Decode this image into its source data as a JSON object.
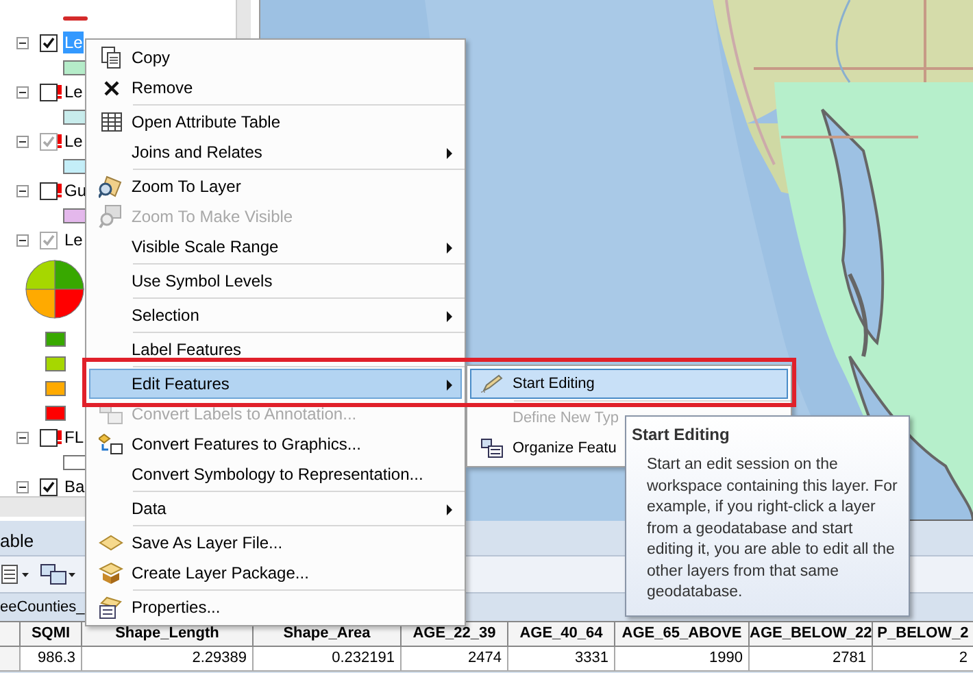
{
  "toc": {
    "leading_symbol": {
      "kind": "line",
      "color": "#d42a2a"
    },
    "layers": [
      {
        "label": "Le",
        "expanded": true,
        "checked": true,
        "dimmed": false,
        "warning": false,
        "selected": true,
        "legend": [
          {
            "kind": "swatch",
            "color": "#b5ecc9"
          }
        ]
      },
      {
        "label": "Le",
        "expanded": true,
        "checked": false,
        "dimmed": false,
        "warning": true,
        "selected": false,
        "legend": [
          {
            "kind": "swatch",
            "color": "#c8ecec"
          }
        ]
      },
      {
        "label": "Le",
        "expanded": true,
        "checked": true,
        "dimmed": true,
        "warning": true,
        "selected": false,
        "legend": [
          {
            "kind": "swatch",
            "color": "#c4eef8"
          }
        ]
      },
      {
        "label": "Gu",
        "expanded": true,
        "checked": false,
        "dimmed": false,
        "warning": true,
        "selected": false,
        "legend": [
          {
            "kind": "swatch",
            "color": "#e4b8ec"
          }
        ]
      },
      {
        "label": "Le",
        "expanded": true,
        "checked": true,
        "dimmed": true,
        "warning": false,
        "selected": false,
        "legend": [
          {
            "kind": "pie"
          },
          {
            "kind": "small",
            "color": "#38a800"
          },
          {
            "kind": "small",
            "color": "#a6d700"
          },
          {
            "kind": "small",
            "color": "#ffaa00"
          },
          {
            "kind": "small",
            "color": "#ff0000"
          }
        ]
      },
      {
        "label": "FL",
        "expanded": true,
        "checked": false,
        "dimmed": false,
        "warning": true,
        "selected": false,
        "legend": [
          {
            "kind": "swatch",
            "color": "#ffffff"
          }
        ]
      },
      {
        "label": "Ba",
        "expanded": true,
        "checked": true,
        "dimmed": false,
        "warning": false,
        "selected": false
      }
    ]
  },
  "table_window": {
    "title": "able",
    "tab": "eeCounties_",
    "columns": [
      "SQMI",
      "Shape_Length",
      "Shape_Area",
      "AGE_22_39",
      "AGE_40_64",
      "AGE_65_ABOVE",
      "AGE_BELOW_22",
      "P_BELOW_2"
    ],
    "rows": [
      [
        "986.3",
        "2.29389",
        "0.232191",
        "2474",
        "3331",
        "1990",
        "2781",
        "2"
      ]
    ]
  },
  "context_menu": {
    "groups": [
      [
        {
          "label": "Copy",
          "disabled": false,
          "submenu": false,
          "selected": false
        },
        {
          "label": "Remove",
          "disabled": false,
          "submenu": false,
          "selected": false
        }
      ],
      [
        {
          "label": "Open Attribute Table",
          "disabled": false,
          "submenu": false,
          "selected": false
        },
        {
          "label": "Joins and Relates",
          "disabled": false,
          "submenu": true,
          "selected": false
        }
      ],
      [
        {
          "label": "Zoom To Layer",
          "disabled": false,
          "submenu": false,
          "selected": false
        },
        {
          "label": "Zoom To Make Visible",
          "disabled": true,
          "submenu": false,
          "selected": false
        },
        {
          "label": "Visible Scale Range",
          "disabled": false,
          "submenu": true,
          "selected": false
        }
      ],
      [
        {
          "label": "Use Symbol Levels",
          "disabled": false,
          "submenu": false,
          "selected": false
        }
      ],
      [
        {
          "label": "Selection",
          "disabled": false,
          "submenu": true,
          "selected": false
        }
      ],
      [
        {
          "label": "Label Features",
          "disabled": false,
          "submenu": false,
          "selected": false
        }
      ],
      [
        {
          "label": "Edit Features",
          "disabled": false,
          "submenu": true,
          "selected": true
        },
        {
          "label": "Convert Labels to Annotation...",
          "disabled": true,
          "submenu": false,
          "selected": false
        },
        {
          "label": "Convert Features to Graphics...",
          "disabled": false,
          "submenu": false,
          "selected": false
        },
        {
          "label": "Convert Symbology to Representation...",
          "disabled": false,
          "submenu": false,
          "selected": false
        }
      ],
      [
        {
          "label": "Data",
          "disabled": false,
          "submenu": true,
          "selected": false
        }
      ],
      [
        {
          "label": "Save As Layer File...",
          "disabled": false,
          "submenu": false,
          "selected": false
        },
        {
          "label": "Create Layer Package...",
          "disabled": false,
          "submenu": false,
          "selected": false
        }
      ],
      [
        {
          "label": "Properties...",
          "disabled": false,
          "submenu": false,
          "selected": false
        }
      ]
    ]
  },
  "submenu": {
    "groups": [
      [
        {
          "label": "Start Editing",
          "disabled": false,
          "selected": true
        }
      ],
      [
        {
          "label": "Define New Typ",
          "disabled": true,
          "selected": false
        },
        {
          "label": "Organize Featu",
          "disabled": false,
          "selected": false
        }
      ]
    ]
  },
  "tooltip": {
    "title": "Start Editing",
    "text": "Start an edit session on the workspace containing this layer. For example, if you right-click a layer from a geodatabase and start editing it, you are able to edit all the other layers from that same geodatabase."
  }
}
